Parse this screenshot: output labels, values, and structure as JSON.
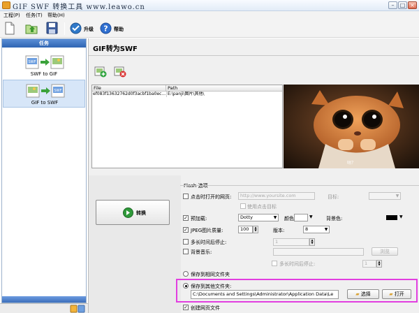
{
  "window": {
    "title": "GIF SWF 转换工具 www.leawo.cn",
    "controls": {
      "minimize": "–",
      "maximize": "□",
      "close": "×"
    }
  },
  "menu": {
    "items": [
      "工程(P)",
      "任务(T)",
      "帮助(H)"
    ]
  },
  "toolbar": {
    "upgrade_label": "升级",
    "help_label": "帮助",
    "icons": [
      "new-file-icon",
      "open-icon",
      "save-icon",
      "upgrade-icon",
      "help-icon"
    ]
  },
  "sidebar": {
    "header": "任务",
    "tasks": [
      {
        "label": "SWF to GIF",
        "selected": false
      },
      {
        "label": "GIF to SWF",
        "selected": true
      }
    ]
  },
  "main": {
    "title": "GIF转为SWF",
    "file_table": {
      "columns": [
        "File",
        "Path"
      ],
      "rows": [
        {
          "file": "ef083f13632762d0f3acbf1ba0ec...",
          "path": "E:\\panji\\图片\\其他\\"
        }
      ]
    },
    "preview_caption": "咕？",
    "convert_label": "转换",
    "flash_options": {
      "group_title": "Flash 选项",
      "open_page": {
        "label": "点击时打开的网页:",
        "placeholder": "http://www.yoursite.com",
        "checked": false
      },
      "target_label": "目标:",
      "use_click_target": "使用点击目标",
      "preloader": {
        "label": "预加载:",
        "value": "Dotty",
        "checked": true
      },
      "color_label": "颜色:",
      "bgcolor_label": "背景色:",
      "bgcolor_value": "#000000",
      "jpeg_quality": {
        "label": "JPEG图片质量:",
        "value": "100",
        "checked": true
      },
      "version": {
        "label": "版本:",
        "value": "8"
      },
      "stop_after": {
        "label": "多长时间后停止:",
        "value": "1",
        "checked": false
      },
      "bg_music": {
        "label": "背景音乐:",
        "checked": false
      },
      "browse_label": "浏览",
      "music_stop_after": {
        "label": "多长时间后停止:",
        "value": "1",
        "checked": false
      }
    },
    "save_same_folder": "保存到相同文件夹",
    "save_other_folder": "保存到其他文件夹:",
    "output_path": "C:\\Documents and Settings\\Administrator\\Application Data\\Le",
    "choose_label": "选择",
    "open_label": "打开",
    "create_webpage": {
      "label": "创建网页文件",
      "checked": true
    }
  },
  "colors": {
    "accent": "#2e64b3",
    "highlight": "#e23ee0",
    "selected_task": "#d7e6f8"
  }
}
